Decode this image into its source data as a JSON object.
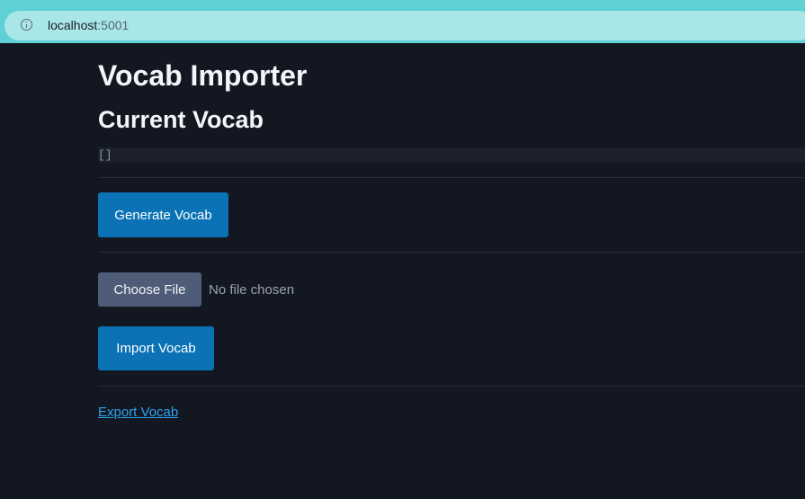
{
  "browser": {
    "url_host": "localhost",
    "url_port": ":5001",
    "info_icon": "info-icon"
  },
  "page": {
    "title": "Vocab Importer",
    "subtitle": "Current Vocab",
    "vocab_content": "[]",
    "generate_button": "Generate Vocab",
    "choose_file_button": "Choose File",
    "file_status": "No file chosen",
    "import_button": "Import Vocab",
    "export_link": "Export Vocab"
  },
  "colors": {
    "background": "#131721",
    "chrome": "#5fd0d4",
    "address_bar": "#a8e6e8",
    "primary_button": "#0a72b5",
    "file_button": "#4e5c78",
    "link": "#2ea3ef"
  }
}
